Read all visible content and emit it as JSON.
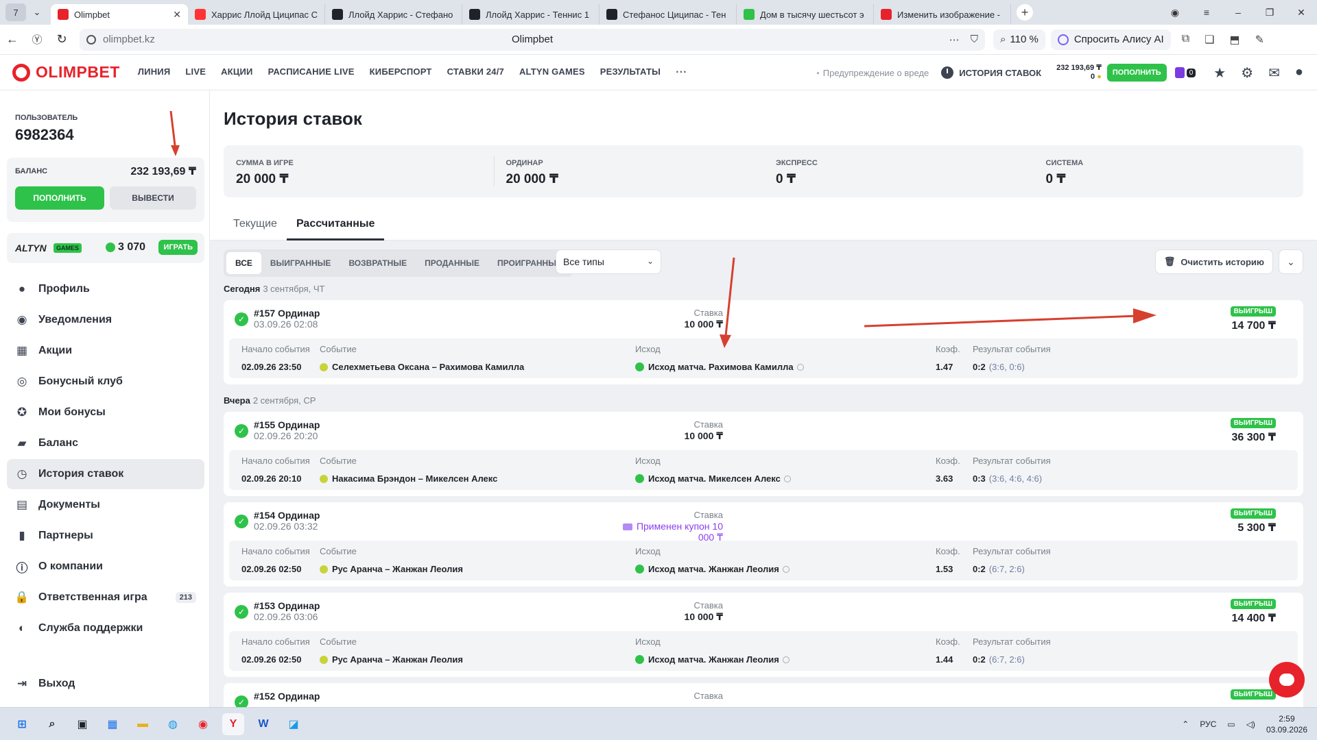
{
  "browser": {
    "tab_counter": "7",
    "tabs": [
      {
        "title": "Olimpbet",
        "active": true,
        "fav_color": "#e8222a"
      },
      {
        "title": "Харрис Ллойд Циципас С",
        "fav_color": "#ff3333"
      },
      {
        "title": "Ллойд Харрис - Стефано",
        "fav_color": "#1f2329"
      },
      {
        "title": "Ллойд Харрис - Теннис 1",
        "fav_color": "#1f2329"
      },
      {
        "title": "Стефанос Циципас - Тен",
        "fav_color": "#1f2329"
      },
      {
        "title": "Дом в тысячу шестьсот э",
        "fav_color": "#2ec24a"
      },
      {
        "title": "Изменить изображение -",
        "fav_color": "#e8222a"
      }
    ],
    "url": "olimpbet.kz",
    "page_title": "Olimpbet",
    "zoom": "110 %",
    "alice_label": "Спросить Алису AI"
  },
  "site": {
    "logo_text": "OLIMPBET",
    "nav": [
      "ЛИНИЯ",
      "LIVE",
      "АКЦИИ",
      "РАСПИСАНИЕ LIVE",
      "КИБЕРСПОРТ",
      "СТАВКИ 24/7",
      "ALTYN GAMES",
      "РЕЗУЛЬТАТЫ"
    ],
    "nav_more": "···",
    "harm_warning": "Предупреждение о вреде",
    "history_link": "ИСТОРИЯ СТАВОК",
    "header_balance": "232 193,69 ₸",
    "header_bonus": "0",
    "deposit_label": "ПОПОЛНИТЬ",
    "bonus_count": "0",
    "accent_color": "#e8222a",
    "green_color": "#2ec24a"
  },
  "sidebar": {
    "user_label": "ПОЛЬЗОВАТЕЛЬ",
    "user_id": "6982364",
    "balance_label": "БАЛАНС",
    "balance_value": "232 193,69 ₸",
    "deposit": "ПОПОЛНИТЬ",
    "withdraw": "ВЫВЕСТИ",
    "games_brand": "ALTYN",
    "games_badge": "GAMES",
    "games_coins": "3 070",
    "games_play": "ИГРАТЬ",
    "items": [
      {
        "label": "Профиль",
        "icon": "person-icon"
      },
      {
        "label": "Уведомления",
        "icon": "chat-icon"
      },
      {
        "label": "Акции",
        "icon": "gift-icon"
      },
      {
        "label": "Бонусный клуб",
        "icon": "club-icon"
      },
      {
        "label": "Мои бонусы",
        "icon": "star-icon"
      },
      {
        "label": "Баланс",
        "icon": "wallet-icon"
      },
      {
        "label": "История ставок",
        "icon": "clock-icon",
        "active": true
      },
      {
        "label": "Документы",
        "icon": "document-icon"
      },
      {
        "label": "Партнеры",
        "icon": "partners-icon"
      },
      {
        "label": "О компании",
        "icon": "info-icon"
      },
      {
        "label": "Ответственная игра",
        "icon": "lock-icon",
        "count": "213"
      },
      {
        "label": "Служба поддержки",
        "icon": "support-icon"
      }
    ],
    "exit": "Выход"
  },
  "main": {
    "title": "История ставок",
    "summary": [
      {
        "label": "СУММА В ИГРЕ",
        "value": "20 000 ₸"
      },
      {
        "label": "ОРДИНАР",
        "value": "20 000 ₸"
      },
      {
        "label": "ЭКСПРЕСС",
        "value": "0 ₸"
      },
      {
        "label": "СИСТЕМА",
        "value": "0 ₸"
      }
    ],
    "tabs": [
      "Текущие",
      "Рассчитанные"
    ],
    "filters": [
      "ВСЕ",
      "ВЫИГРАННЫЕ",
      "ВОЗВРАТНЫЕ",
      "ПРОДАННЫЕ",
      "ПРОИГРАННЫЕ"
    ],
    "type_select": "Все типы",
    "clear_history": "Очистить историю",
    "day_today": "Сегодня",
    "day_today_sub": "3 сентября, ЧТ",
    "day_yesterday": "Вчера",
    "day_yesterday_sub": "2 сентября, СР",
    "detail_headers": {
      "start": "Начало события",
      "event": "Событие",
      "outcome": "Исход",
      "coef": "Коэф.",
      "result": "Результат события"
    },
    "stake_label": "Ставка",
    "win_badge": "ВЫИГРЫШ",
    "bets": [
      {
        "num": "#157 Ординар",
        "dt": "03.09.26 02:08",
        "stake": "10 000 ₸",
        "win": "14 700 ₸",
        "start": "02.09.26 23:50",
        "event": "Селехметьева Оксана – Рахимова Камилла",
        "outcome": "Исход матча. Рахимова Камилла",
        "coef": "1.47",
        "score": "0:2",
        "score_sub": "(3:6, 0:6)"
      },
      {
        "num": "#155 Ординар",
        "dt": "02.09.26 20:20",
        "stake": "10 000 ₸",
        "win": "36 300 ₸",
        "start": "02.09.26 20:10",
        "event": "Накасима Брэндон – Микелсен Алекс",
        "outcome": "Исход матча. Микелсен Алекс",
        "coef": "3.63",
        "score": "0:3",
        "score_sub": "(3:6, 4:6, 4:6)"
      },
      {
        "num": "#154 Ординар",
        "dt": "02.09.26 03:32",
        "stake": "Применен купон 10 000 ₸",
        "coupon": true,
        "win": "5 300 ₸",
        "start": "02.09.26 02:50",
        "event": "Рус Аранча – Жанжан Леолия",
        "outcome": "Исход матча. Жанжан Леолия",
        "coef": "1.53",
        "score": "0:2",
        "score_sub": "(6:7, 2:6)"
      },
      {
        "num": "#153 Ординар",
        "dt": "02.09.26 03:06",
        "stake": "10 000 ₸",
        "win": "14 400 ₸",
        "start": "02.09.26 02:50",
        "event": "Рус Аранча – Жанжан Леолия",
        "outcome": "Исход матча. Жанжан Леолия",
        "coef": "1.44",
        "score": "0:2",
        "score_sub": "(6:7, 2:6)"
      },
      {
        "num": "#152 Ординар",
        "stake_label_only": true
      }
    ]
  },
  "taskbar": {
    "lang": "РУС",
    "time": "2:59",
    "date": "03.09.2026"
  }
}
